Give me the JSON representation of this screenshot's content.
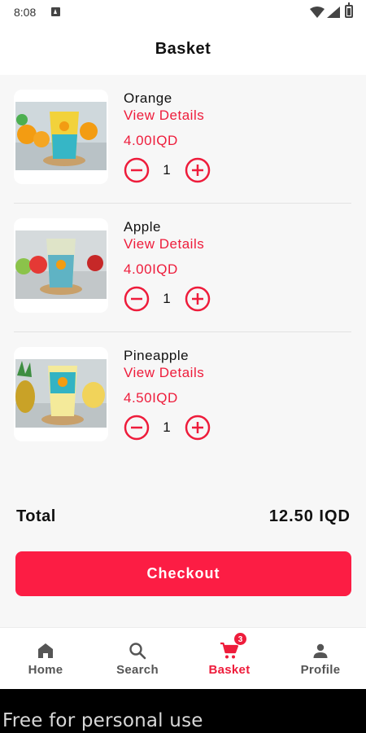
{
  "status_bar": {
    "time": "8:08"
  },
  "header": {
    "title": "Basket"
  },
  "items": [
    {
      "name": "Orange",
      "details_label": "View Details",
      "price": "4.00IQD",
      "quantity": "1",
      "image": "orange-juice-cup"
    },
    {
      "name": "Apple",
      "details_label": "View Details",
      "price": "4.00IQD",
      "quantity": "1",
      "image": "apple-juice-cup"
    },
    {
      "name": "Pineapple",
      "details_label": "View Details",
      "price": "4.50IQD",
      "quantity": "1",
      "image": "pineapple-juice-cup"
    }
  ],
  "summary": {
    "total_label": "Total",
    "total_value": "12.50 IQD"
  },
  "checkout": {
    "label": "Checkout"
  },
  "nav": {
    "items": [
      {
        "label": "Home",
        "icon": "home-icon"
      },
      {
        "label": "Search",
        "icon": "search-icon"
      },
      {
        "label": "Basket",
        "icon": "cart-icon",
        "badge": "3",
        "active": true
      },
      {
        "label": "Profile",
        "icon": "person-icon"
      }
    ]
  },
  "watermark": {
    "text": "Free for personal use"
  },
  "colors": {
    "accent": "#EE1C3B",
    "button": "#FC1D44",
    "background": "#F7F7F7"
  }
}
